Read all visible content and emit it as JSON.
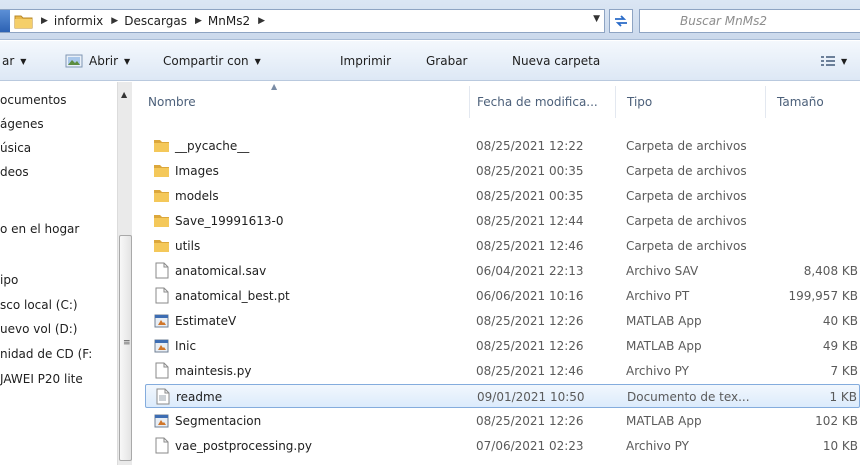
{
  "window": {
    "breadcrumb": [
      "informix",
      "Descargas",
      "MnMs2"
    ],
    "search_placeholder": "Buscar MnMs2"
  },
  "toolbar": {
    "organize_label": "ar",
    "open_label": "Abrir",
    "share_label": "Compartir con",
    "print_label": "Imprimir",
    "burn_label": "Grabar",
    "new_folder_label": "Nueva carpeta"
  },
  "nav": {
    "items": [
      "ocumentos",
      "ágenes",
      "úsica",
      "deos",
      "o en el hogar",
      "ipo",
      "sco local (C:)",
      "uevo vol (D:)",
      "nidad de CD (F:",
      "JAWEI P20 lite"
    ]
  },
  "columns": {
    "name": "Nombre",
    "date": "Fecha de modifica...",
    "type": "Tipo",
    "size": "Tamaño"
  },
  "files": [
    {
      "name": "__pycache__",
      "date": "08/25/2021 12:22",
      "type": "Carpeta de archivos",
      "size": "",
      "icon": "folder-icon"
    },
    {
      "name": "Images",
      "date": "08/25/2021 00:35",
      "type": "Carpeta de archivos",
      "size": "",
      "icon": "folder-icon"
    },
    {
      "name": "models",
      "date": "08/25/2021 00:35",
      "type": "Carpeta de archivos",
      "size": "",
      "icon": "folder-icon"
    },
    {
      "name": "Save_19991613-0",
      "date": "08/25/2021 12:44",
      "type": "Carpeta de archivos",
      "size": "",
      "icon": "folder-icon"
    },
    {
      "name": "utils",
      "date": "08/25/2021 12:46",
      "type": "Carpeta de archivos",
      "size": "",
      "icon": "folder-icon"
    },
    {
      "name": "anatomical.sav",
      "date": "06/04/2021 22:13",
      "type": "Archivo SAV",
      "size": "8,408 KB",
      "icon": "file-icon"
    },
    {
      "name": "anatomical_best.pt",
      "date": "06/06/2021 10:16",
      "type": "Archivo PT",
      "size": "199,957 KB",
      "icon": "file-icon"
    },
    {
      "name": "EstimateV",
      "date": "08/25/2021 12:26",
      "type": "MATLAB App",
      "size": "40 KB",
      "icon": "app-icon"
    },
    {
      "name": "Inic",
      "date": "08/25/2021 12:26",
      "type": "MATLAB App",
      "size": "49 KB",
      "icon": "app-icon"
    },
    {
      "name": "maintesis.py",
      "date": "08/25/2021 12:46",
      "type": "Archivo PY",
      "size": "7 KB",
      "icon": "file-icon"
    },
    {
      "name": "readme",
      "date": "09/01/2021 10:50",
      "type": "Documento de tex...",
      "size": "1 KB",
      "icon": "text-file-icon",
      "selected": true
    },
    {
      "name": "Segmentacion",
      "date": "08/25/2021 12:26",
      "type": "MATLAB App",
      "size": "102 KB",
      "icon": "app-icon"
    },
    {
      "name": "vae_postprocessing.py",
      "date": "07/06/2021 02:23",
      "type": "Archivo PY",
      "size": "10 KB",
      "icon": "file-icon"
    }
  ],
  "colors": {
    "selection_border": "#84acdd",
    "folder": "#e8b84a",
    "header_text": "#4c607a"
  }
}
